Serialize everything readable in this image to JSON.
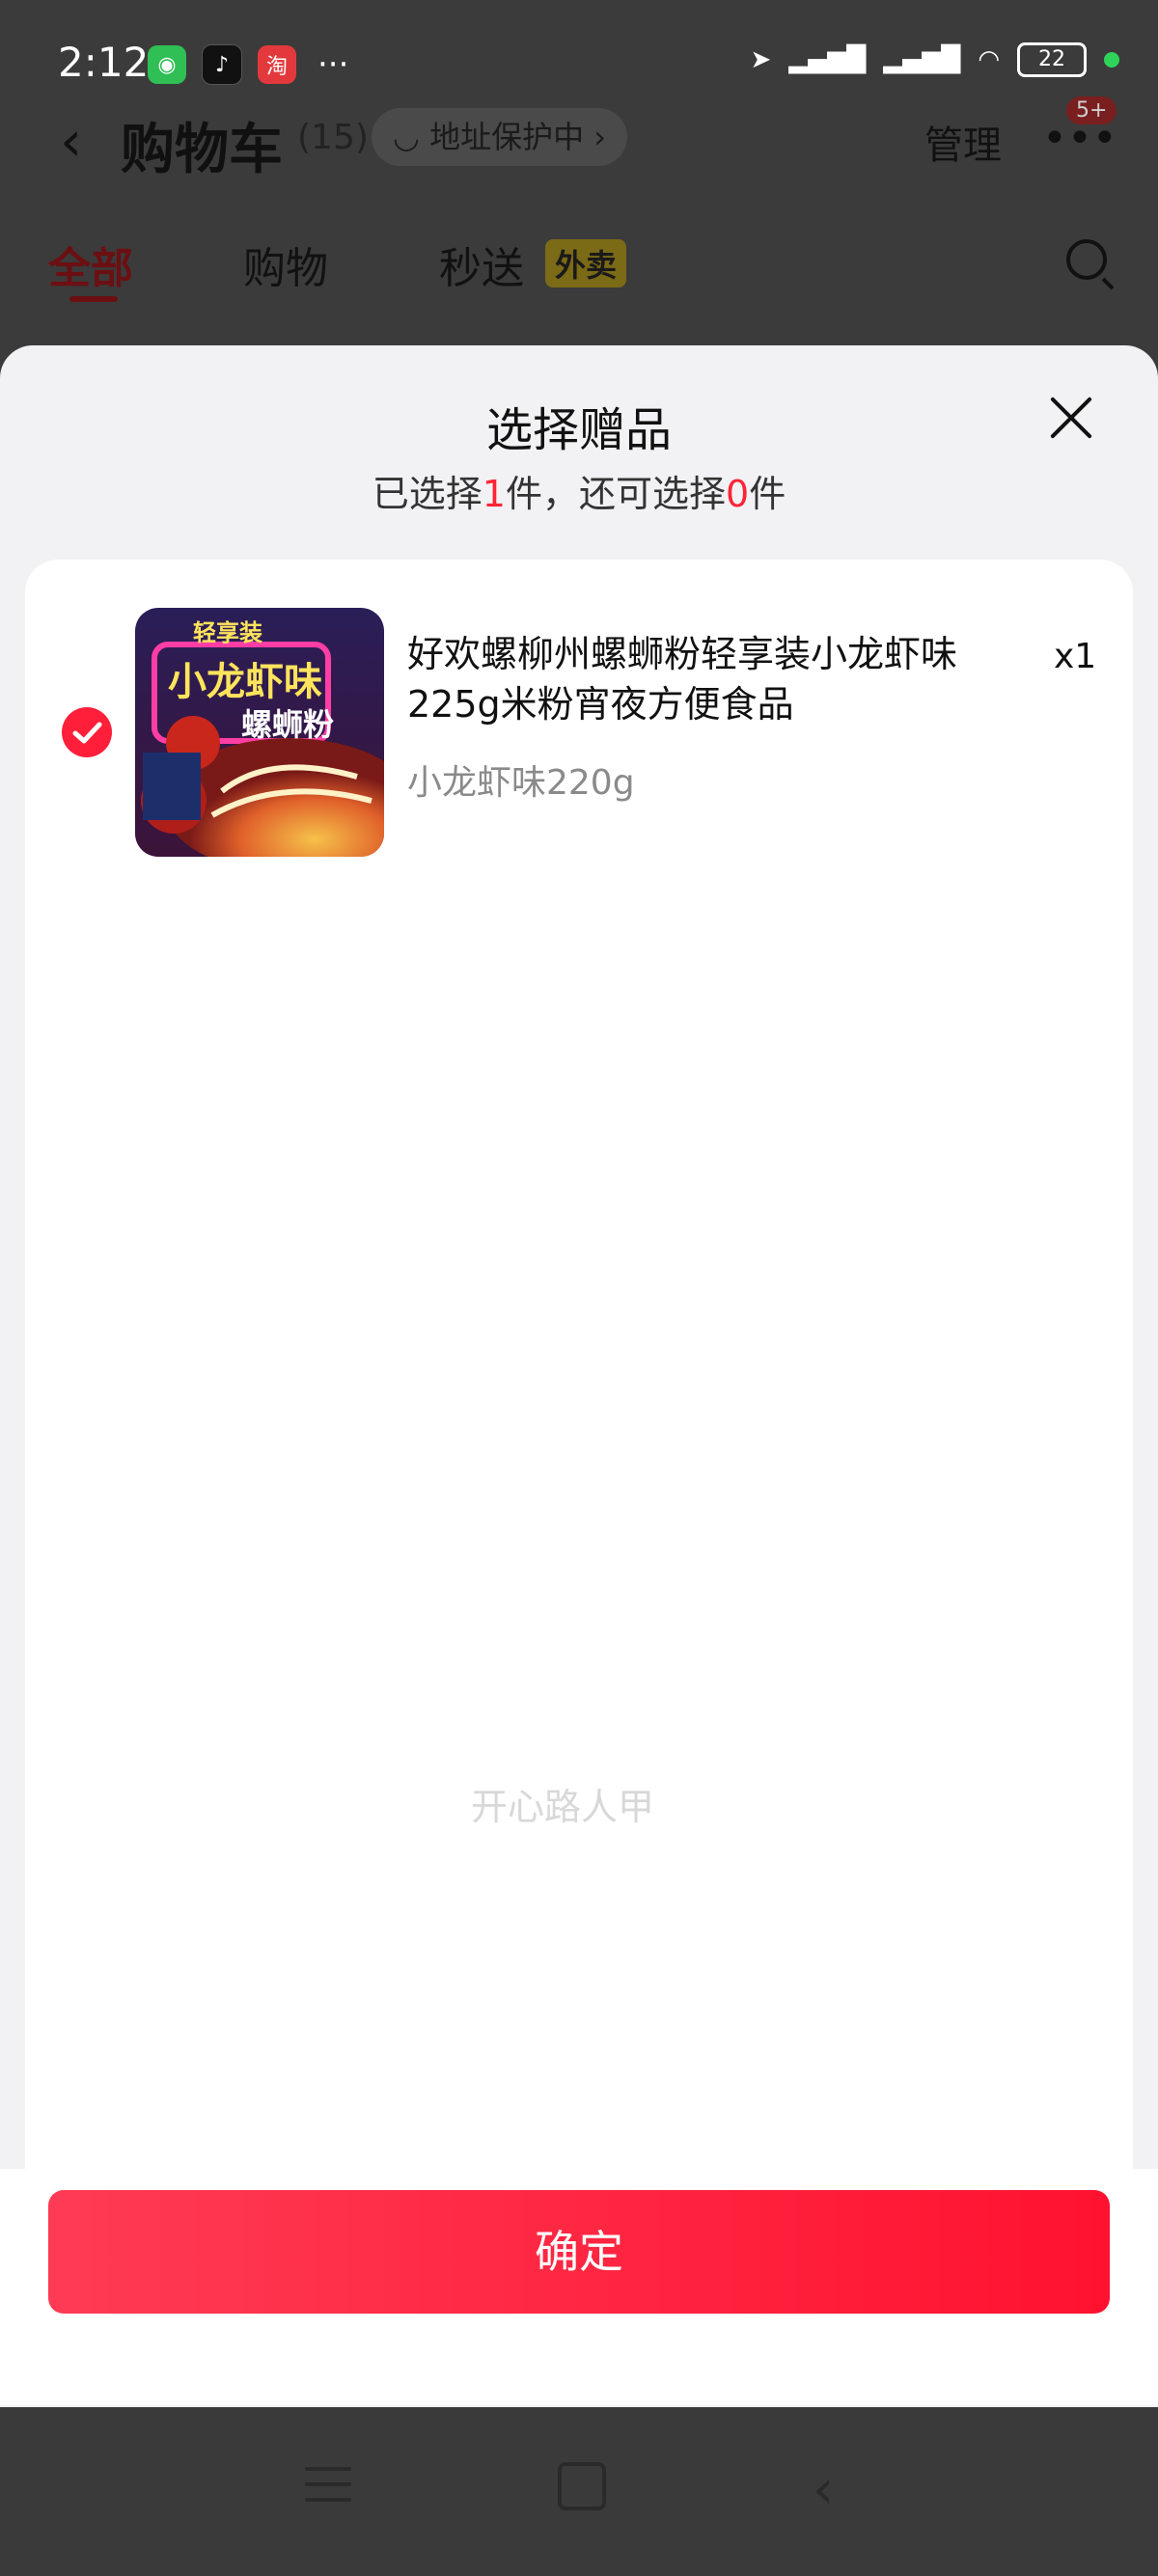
{
  "status_bar": {
    "time": "2:12",
    "battery": "22",
    "dots": "···"
  },
  "background_page": {
    "title": "购物车",
    "count": "(15)",
    "address_pill": "◡ 地址保护中 ›",
    "manage": "管理",
    "more_badge": "5+",
    "tabs": [
      "全部",
      "购物",
      "秒送"
    ],
    "tab_badge": "外卖"
  },
  "sheet": {
    "title": "选择赠品",
    "subtitle_prefix": "已选择",
    "selected_count": "1",
    "subtitle_mid": "件，还可选择",
    "remaining_count": "0",
    "subtitle_suffix": "件"
  },
  "product": {
    "title": "好欢螺柳州螺蛳粉轻享装小龙虾味225g米粉宵夜方便食品",
    "quantity": "x1",
    "spec": "小龙虾味220g",
    "image_text_top": "轻享装",
    "image_text_main": "小龙虾味",
    "image_text_sub": "螺蛳粉"
  },
  "watermark": "开心路人甲",
  "confirm_label": "确定",
  "colors": {
    "accent": "#ff1f3a",
    "button_gradient_start": "#ff3b54",
    "button_gradient_end": "#ff1230"
  },
  "icons": {
    "close": "close-icon",
    "check": "check-circle-icon",
    "back": "chevron-left-icon",
    "search": "search-icon"
  }
}
